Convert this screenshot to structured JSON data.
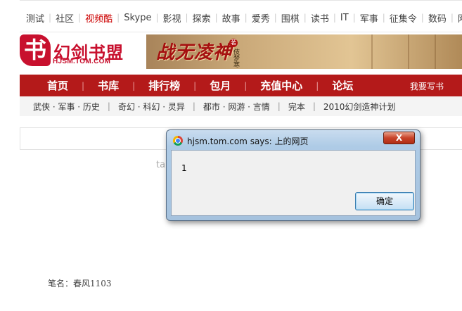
{
  "topnav": {
    "items": [
      {
        "label": "测试",
        "hot": false
      },
      {
        "label": "社区",
        "hot": false
      },
      {
        "label": "视频酷",
        "hot": true
      },
      {
        "label": "Skype",
        "hot": false
      },
      {
        "label": "影视",
        "hot": false
      },
      {
        "label": "探索",
        "hot": false
      },
      {
        "label": "故事",
        "hot": false
      },
      {
        "label": "爱秀",
        "hot": false
      },
      {
        "label": "围棋",
        "hot": false
      },
      {
        "label": "读书",
        "hot": false
      },
      {
        "label": "IT",
        "hot": false
      },
      {
        "label": "军事",
        "hot": false
      },
      {
        "label": "征集令",
        "hot": false
      },
      {
        "label": "数码",
        "hot": false
      },
      {
        "label": "网上",
        "hot": false
      }
    ]
  },
  "logo": {
    "mark": "书",
    "text": "幻剑书盟",
    "sub": "HJSM.TOM.COM"
  },
  "banner": {
    "title": "战无凌神",
    "seal": "著",
    "author": "伎梦寒"
  },
  "mainnav": {
    "items": [
      "首页",
      "书库",
      "排行榜",
      "包月",
      "充值中心",
      "论坛"
    ],
    "right": "我要写书"
  },
  "subnav": {
    "items": [
      "武侠 · 军事 · 历史",
      "奇幻 · 科幻 · 灵异",
      "都市 · 网游 · 言情",
      "完本",
      "2010幻剑造神计划"
    ]
  },
  "page": {
    "hidden_text": "ta",
    "penname": "笔名：春风1103"
  },
  "dialog": {
    "title": "hjsm.tom.com says: 上的网页",
    "close_label": "X",
    "message": "1",
    "ok_label": "确定"
  },
  "colors": {
    "nav_red": "#b41a1a",
    "brand_red": "#c8102e",
    "hot_link": "#cc0000"
  }
}
